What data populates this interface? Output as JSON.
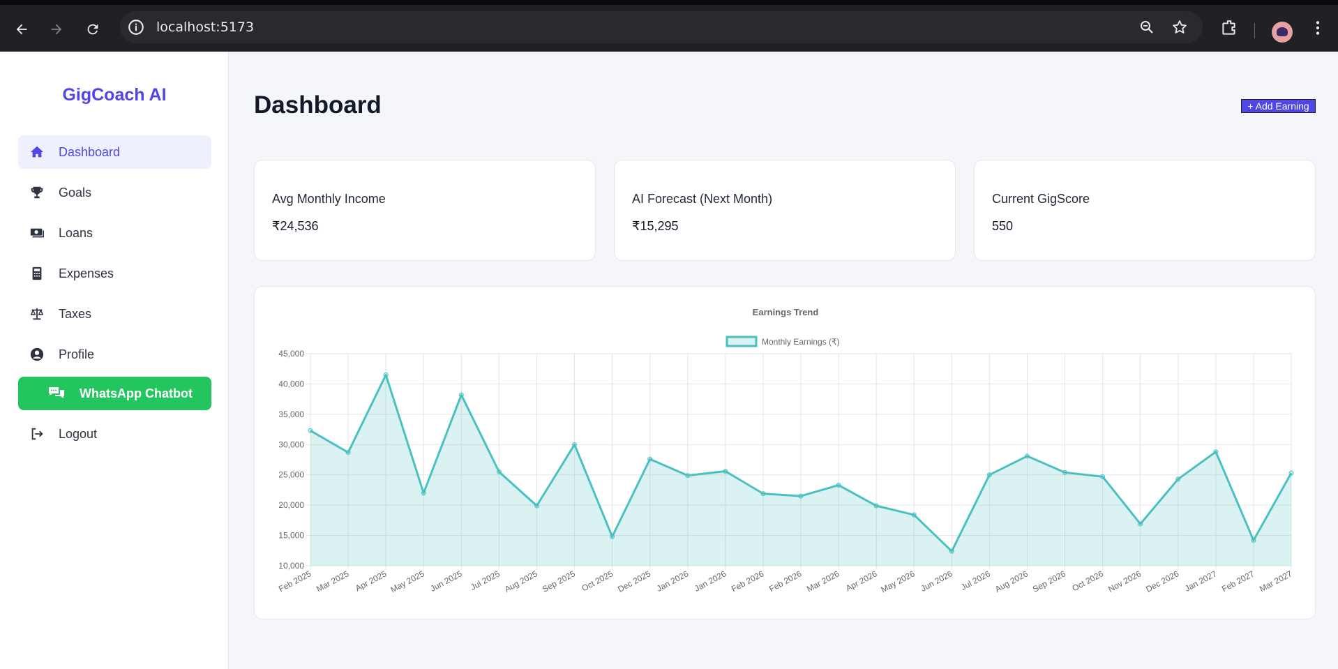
{
  "browser": {
    "url": "localhost:5173"
  },
  "sidebar": {
    "brand": "GigCoach AI",
    "items": [
      {
        "label": "Dashboard",
        "icon": "home-icon"
      },
      {
        "label": "Goals",
        "icon": "trophy-icon"
      },
      {
        "label": "Loans",
        "icon": "money-icon"
      },
      {
        "label": "Expenses",
        "icon": "calculator-icon"
      },
      {
        "label": "Taxes",
        "icon": "scale-icon"
      },
      {
        "label": "Profile",
        "icon": "user-circle-icon"
      }
    ],
    "whatsapp_label": "WhatsApp Chatbot",
    "logout_label": "Logout"
  },
  "main": {
    "title": "Dashboard",
    "add_button": "+ Add Earning",
    "cards": [
      {
        "label": "Avg Monthly Income",
        "value": "₹24,536"
      },
      {
        "label": "AI Forecast (Next Month)",
        "value": "₹15,295"
      },
      {
        "label": "Current GigScore",
        "value": "550"
      }
    ]
  },
  "colors": {
    "accent": "#4f46e5",
    "whatsapp": "#22c55e",
    "line": "#4bc0c0",
    "fill": "rgba(75,192,192,0.2)"
  },
  "chart_data": {
    "type": "line",
    "title": "Earnings Trend",
    "legend_position": "top",
    "grid": true,
    "ylim": [
      10000,
      45000
    ],
    "y_ticks": [
      "10,000",
      "15,000",
      "20,000",
      "25,000",
      "30,000",
      "35,000",
      "40,000",
      "45,000"
    ],
    "categories": [
      "Feb 2025",
      "Mar 2025",
      "Apr 2025",
      "May 2025",
      "Jun 2025",
      "Jul 2025",
      "Aug 2025",
      "Sep 2025",
      "Oct 2025",
      "Dec 2025",
      "Jan 2026",
      "Jan 2026",
      "Feb 2026",
      "Feb 2026",
      "Mar 2026",
      "Apr 2026",
      "May 2026",
      "Jun 2026",
      "Jul 2026",
      "Aug 2026",
      "Sep 2026",
      "Oct 2026",
      "Nov 2026",
      "Dec 2026",
      "Jan 2027",
      "Feb 2027",
      "Mar 2027"
    ],
    "series": [
      {
        "name": "Monthly Earnings (₹)",
        "values": [
          32300,
          28700,
          41500,
          22000,
          38200,
          25500,
          19900,
          30000,
          14800,
          27600,
          24900,
          25600,
          21900,
          21500,
          23300,
          19900,
          18400,
          12400,
          25000,
          28100,
          25400,
          24700,
          16900,
          24300,
          28800,
          14200,
          25300
        ]
      }
    ]
  }
}
